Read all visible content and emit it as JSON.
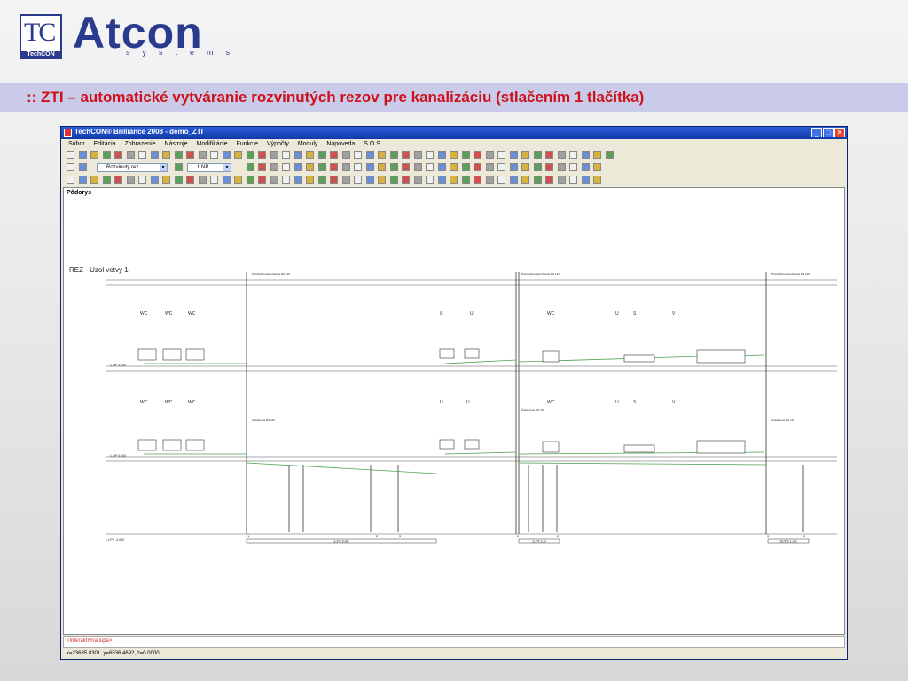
{
  "logo": {
    "mark": "TC",
    "mark_sub": "TechCON",
    "brand": "Atcon",
    "brand_sub": "systems",
    "brand_color": "#2a3a8c"
  },
  "slide": {
    "title": ":: ZTI – automatické vytváranie rozvinutých rezov pre kanalizáciu (stlačením 1 tlačítka)",
    "title_color": "#d0101a"
  },
  "window": {
    "title": "TechCON® Brilliance 2008 - demo_ZTI",
    "controls": [
      "_",
      "□",
      "✕"
    ]
  },
  "menu": [
    "Súbor",
    "Editácia",
    "Zobrazenie",
    "Nástroje",
    "Modifikácie",
    "Funkcie",
    "Výpočty",
    "Moduly",
    "Nápoveda",
    "S.O.S."
  ],
  "toolbar": {
    "layer_combo": "Rozvinutý rez",
    "floor_combo": "1.NP"
  },
  "drawing": {
    "view_label": "Pôdorys",
    "section_title": "REZ - Uzol vetvy 1",
    "fixtures_upper": [
      "WC",
      "WC",
      "WC",
      "U",
      "U",
      "WC",
      "U",
      "S",
      "V"
    ],
    "fixtures_lower": [
      "WC",
      "WC",
      "WC",
      "U",
      "U",
      "WC",
      "U",
      "S",
      "V"
    ],
    "floor_labels": [
      "2.NP 3.000",
      "1.NP 0.000",
      "-1.PP -3.000"
    ],
    "vent_label": "Privzdušňovacia hlavica DN 110",
    "cleanout_label": "Čistiaci kus DN 110",
    "dims": [
      "3.2% 6.9m",
      "3.2% 1.m",
      "10.5% 1.2m"
    ],
    "node_labels": [
      "1",
      "2",
      "3",
      "2",
      "2",
      "3",
      "3"
    ]
  },
  "command": {
    "text": "<Interaktívna lupa>"
  },
  "status": {
    "coords": "x=23685.8301, y=6536.4692, z=0.0000"
  }
}
